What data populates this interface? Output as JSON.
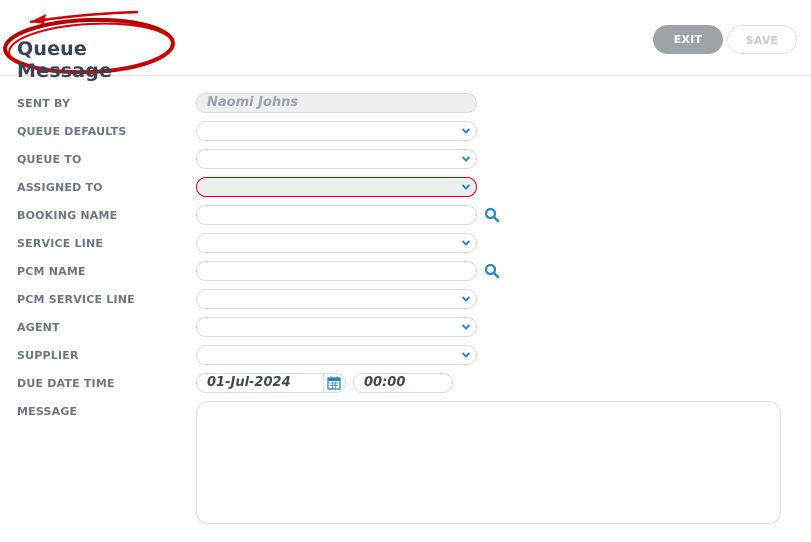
{
  "header": {
    "title": "Queue Message",
    "exit_label": "EXIT",
    "save_label": "SAVE"
  },
  "form": {
    "sent_by": {
      "label": "SENT BY",
      "value": "Naomi Johns"
    },
    "queue_defaults": {
      "label": "QUEUE DEFAULTS",
      "value": ""
    },
    "queue_to": {
      "label": "QUEUE TO",
      "value": ""
    },
    "assigned_to": {
      "label": "ASSIGNED TO",
      "value": ""
    },
    "booking_name": {
      "label": "BOOKING NAME",
      "value": ""
    },
    "service_line": {
      "label": "SERVICE LINE",
      "value": ""
    },
    "pcm_name": {
      "label": "PCM NAME",
      "value": ""
    },
    "pcm_service_line": {
      "label": "PCM SERVICE LINE",
      "value": ""
    },
    "agent": {
      "label": "AGENT",
      "value": ""
    },
    "supplier": {
      "label": "SUPPLIER",
      "value": ""
    },
    "due_date_time": {
      "label": "DUE DATE TIME",
      "date": "01-Jul-2024",
      "time": "00:00"
    },
    "message": {
      "label": "MESSAGE",
      "value": ""
    }
  },
  "colors": {
    "accent": "#2e86c1",
    "error": "#d9001b",
    "exit_bg": "#9ea3a8",
    "annotation": "#cc0000"
  },
  "icons": {
    "chevron": "chevron-down-icon",
    "search": "search-icon",
    "calendar": "calendar-icon"
  }
}
